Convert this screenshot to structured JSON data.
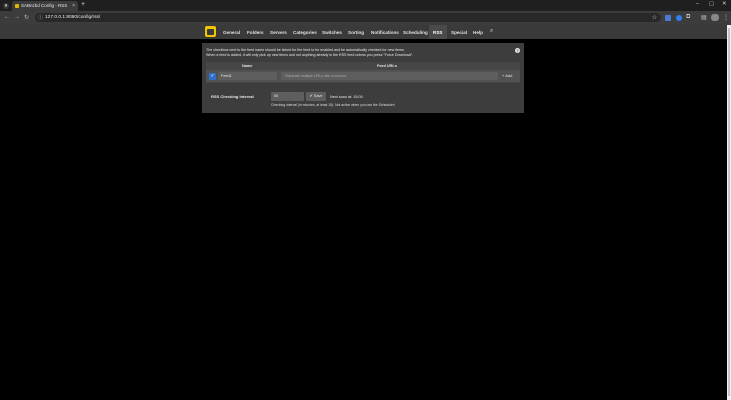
{
  "browser": {
    "tab_title": "SABnzbd Config - RSS",
    "url": "127.0.0.1:8080/config/rss/",
    "tab_close": "×",
    "new_tab": "+"
  },
  "nav": {
    "items": [
      {
        "label": "General"
      },
      {
        "label": "Folders"
      },
      {
        "label": "Servers"
      },
      {
        "label": "Categories"
      },
      {
        "label": "Switches"
      },
      {
        "label": "Sorting"
      },
      {
        "label": "Notifications"
      },
      {
        "label": "Scheduling"
      },
      {
        "label": "RSS"
      },
      {
        "label": "Special"
      },
      {
        "label": "Help"
      }
    ],
    "active": "RSS"
  },
  "rss": {
    "description_line1": "The checkbox next to the feed name should be ticked for the feed to be enabled and be automatically checked for new items.",
    "description_line2": "When a feed is added, it will only pick up new items and not anything already in the RSS feed unless you press \"Force Download\".",
    "table": {
      "col_name": "Name",
      "col_urls": "Feed URLs",
      "feed_name_value": "Feed1",
      "url_placeholder": "Separate multiple URLs with a comma",
      "add_label": "+ Add"
    },
    "interval": {
      "label": "RSS Checking Interval",
      "value": "60",
      "save_label": "Save",
      "next_scan": "Next scan at: 15:00",
      "note": "Checking interval (in minutes, at least 15). Not active when you use the Scheduler!"
    },
    "help_symbol": "?"
  },
  "colors": {
    "accent": "#2f6fd0",
    "logo": "#f0c400"
  }
}
